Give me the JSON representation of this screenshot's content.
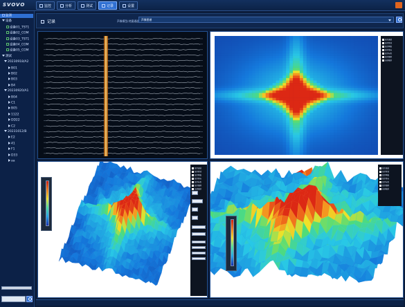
{
  "app": {
    "logo": "SVOVO",
    "close_color": "#e0641e"
  },
  "nav": [
    {
      "label": "监控",
      "active": false
    },
    {
      "label": "分析",
      "active": false
    },
    {
      "label": "测试",
      "active": false
    },
    {
      "label": "记录",
      "active": true
    },
    {
      "label": "设置",
      "active": false
    }
  ],
  "sidebar": {
    "rows": [
      {
        "label": "监测",
        "depth": 0,
        "kind": "sq",
        "selected": true
      },
      {
        "label": "设备",
        "depth": 0,
        "kind": "tri"
      },
      {
        "label": "设备01_TST1",
        "depth": 2,
        "kind": "sqg"
      },
      {
        "label": "设备02_COM",
        "depth": 2,
        "kind": "sqg"
      },
      {
        "label": "设备03_TST1",
        "depth": 2,
        "kind": "sqg"
      },
      {
        "label": "设备04_COM",
        "depth": 2,
        "kind": "sqg"
      },
      {
        "label": "设备05_COM",
        "depth": 2,
        "kind": "sqg"
      },
      {
        "label": "测试",
        "depth": 0,
        "kind": "tri"
      },
      {
        "label": "20230918/A2",
        "depth": 1,
        "kind": "tri"
      },
      {
        "label": "B01",
        "depth": 3,
        "kind": "trir"
      },
      {
        "label": "B02",
        "depth": 3,
        "kind": "trir"
      },
      {
        "label": "B03",
        "depth": 3,
        "kind": "trir"
      },
      {
        "label": "B4",
        "depth": 3,
        "kind": "trir"
      },
      {
        "label": "20230920/A1",
        "depth": 1,
        "kind": "tri"
      },
      {
        "label": "B04",
        "depth": 3,
        "kind": "trir"
      },
      {
        "label": "C1",
        "depth": 3,
        "kind": "trir"
      },
      {
        "label": "B05",
        "depth": 3,
        "kind": "trir"
      },
      {
        "label": "1122",
        "depth": 3,
        "kind": "trir"
      },
      {
        "label": "DD22",
        "depth": 3,
        "kind": "trir"
      },
      {
        "label": "C2",
        "depth": 3,
        "kind": "trir"
      },
      {
        "label": "20231012/B",
        "depth": 1,
        "kind": "tri"
      },
      {
        "label": "E2",
        "depth": 3,
        "kind": "trir"
      },
      {
        "label": "41",
        "depth": 3,
        "kind": "trir"
      },
      {
        "label": "F1",
        "depth": 3,
        "kind": "trir"
      },
      {
        "label": "D33",
        "depth": 3,
        "kind": "trir"
      },
      {
        "label": "aa",
        "depth": 3,
        "kind": "trir"
      }
    ]
  },
  "header": {
    "title": "记录",
    "select_label": "声像模型(地震通道)",
    "select_value": "声像图谱"
  },
  "legend_items": [
    "显示通道",
    "显示区域",
    "显示网格",
    "显示坐标",
    "显示标签",
    "显示图例",
    "自动缩放"
  ],
  "right_legend_items": [
    "显示通道",
    "显示区域",
    "显示网格",
    "显示坐标",
    "显示标签",
    "显示图例",
    "自动缩放"
  ],
  "colors": {
    "accent": "#2f6fd1",
    "panel_border": "#24508f"
  }
}
